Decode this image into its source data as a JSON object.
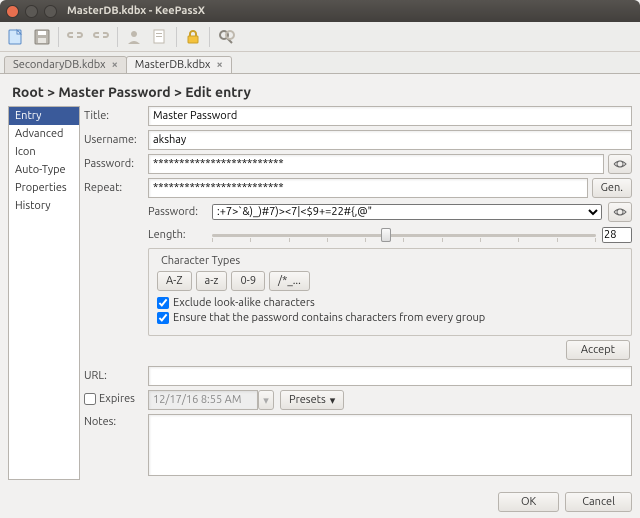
{
  "window": {
    "title": "MasterDB.kdbx - KeePassX"
  },
  "dbtabs": [
    {
      "label": "SecondaryDB.kdbx",
      "active": false
    },
    {
      "label": "MasterDB.kdbx",
      "active": true
    }
  ],
  "breadcrumb": "Root > Master Password > Edit entry",
  "sidebar": {
    "items": [
      "Entry",
      "Advanced",
      "Icon",
      "Auto-Type",
      "Properties",
      "History"
    ],
    "selected": 0
  },
  "labels": {
    "title": "Title:",
    "username": "Username:",
    "password": "Password:",
    "repeat": "Repeat:",
    "gen_password": "Password:",
    "length": "Length:",
    "char_types": "Character Types",
    "url": "URL:",
    "expires": "Expires",
    "notes": "Notes:"
  },
  "entry": {
    "title": "Master Password",
    "username": "akshay",
    "password_masked": "*************************",
    "repeat_masked": "*************************",
    "url": "",
    "expires_checked": false,
    "expires_value": "12/17/16 8:55 AM",
    "notes": ""
  },
  "generator": {
    "password_value": ":+7>`&)_)#7)><7|<$9+=22#{,@\"",
    "length": "28",
    "char_buttons": [
      "A-Z",
      "a-z",
      "0-9",
      "/*_..."
    ],
    "exclude_lookalike": {
      "label": "Exclude look-alike characters",
      "checked": true
    },
    "ensure_every_group": {
      "label": "Ensure that the password contains characters from every group",
      "checked": true
    }
  },
  "buttons": {
    "gen": "Gen.",
    "accept": "Accept",
    "presets": "Presets",
    "ok": "OK",
    "cancel": "Cancel"
  },
  "icons": {
    "close": "close-icon",
    "min": "minimize-icon",
    "new": "new-db-icon",
    "save": "save-icon",
    "link1": "link-icon",
    "link2": "link-icon",
    "user": "user-icon",
    "docnew": "new-entry-icon",
    "lock": "lock-icon",
    "search": "search-icon",
    "eye": "eye-icon",
    "dropdown": "chevron-down-icon"
  }
}
